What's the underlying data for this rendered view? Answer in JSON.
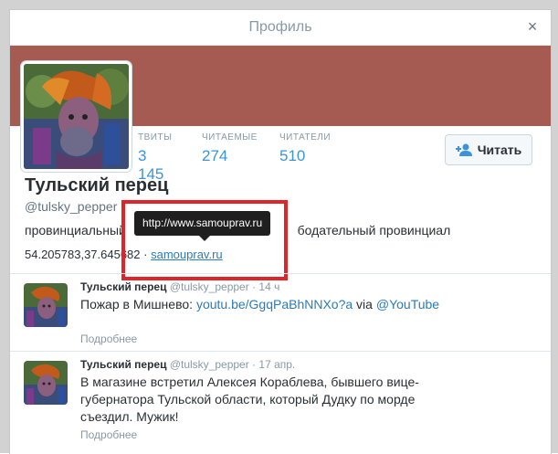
{
  "dialog": {
    "title": "Профиль",
    "close_glyph": "×"
  },
  "colors": {
    "banner": "#a55b52",
    "link": "#2b7bb9",
    "stat_value": "#3b94d9",
    "highlight": "#e0252a"
  },
  "profile": {
    "stats": [
      {
        "label": "ТВИТЫ",
        "value": "3 145"
      },
      {
        "label": "ЧИТАЕМЫЕ",
        "value": "274"
      },
      {
        "label": "ЧИТАТЕЛИ",
        "value": "510"
      }
    ],
    "follow_label": "Читать",
    "follow_icon": "add-user-icon",
    "name": "Тульский перец",
    "handle": "@tulsky_pepper",
    "bio": "провинциальный ... бодательный провинциал",
    "bio_left": "провинциальный",
    "bio_right": "бодательный провинциал",
    "location": "54.205783,37.645682",
    "location_sep": "·",
    "website": "samouprav.ru",
    "tooltip": "http://www.samouprav.ru"
  },
  "tweets": [
    {
      "name": "Тульский перец",
      "handle": "@tulsky_pepper",
      "sep": "·",
      "time": "14 ч",
      "text_prefix": "Пожар в Мишнево: ",
      "link": "youtu.be/GgqPaBhNNXo?a",
      "text_mid": " via ",
      "mention": "@YouTube",
      "more": "Подробнее"
    },
    {
      "name": "Тульский перец",
      "handle": "@tulsky_pepper",
      "sep": "·",
      "time": "17 апр.",
      "text": "В магазине встретил Алексея Кораблева, бывшего вице-губернатора Тульской области, который Дудку по морде съездил. Мужик!",
      "more": "Подробнее"
    }
  ]
}
